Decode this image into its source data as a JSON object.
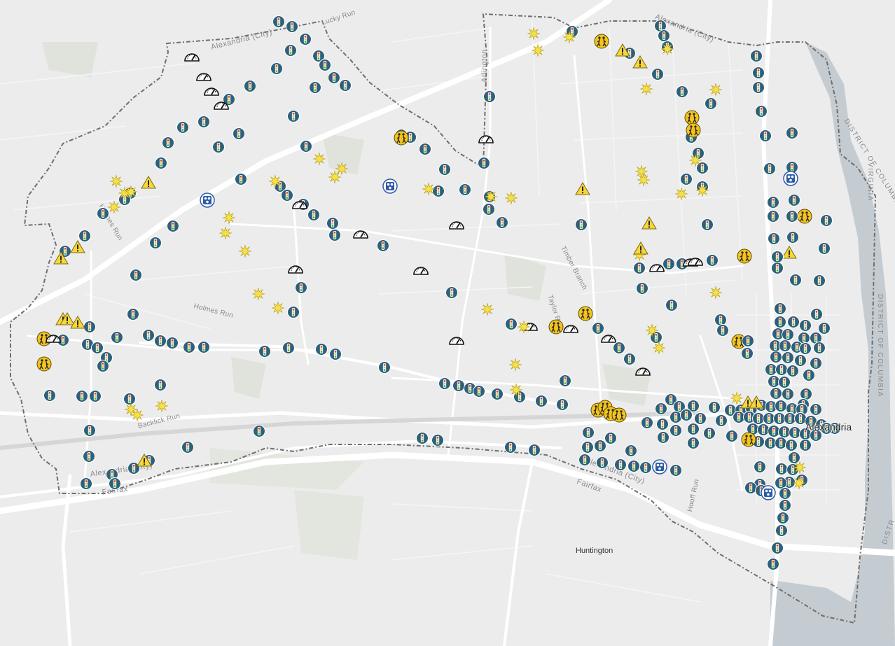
{
  "map": {
    "colors": {
      "background": "#ececec",
      "water": "#c4ccd2",
      "park": "#dfe3dc",
      "road_major": "#ffffff",
      "road_minor": "#fafafa",
      "boundary": "#6e6e6e",
      "signal_fill": "#2e6079",
      "signal_red": "#e53b2f",
      "signal_yellow": "#f2c12e",
      "signal_green": "#3dbb4a",
      "star_fill": "#f5e04a",
      "warning_fill": "#f7d63a",
      "school_fill": "#f3c31e",
      "speed_fill": "#ffffff",
      "police_fill": "#2d5aa6"
    },
    "labels": {
      "alexandria": "Alexandria",
      "huntington": "Huntington",
      "alexandria_city_top_left": "Alexandria (City)",
      "alexandria_city_top_right": "Alexandria (City)",
      "alexandria_city_bottom_left": "Alexandria (City)",
      "alexandria_city_bottom_right": "Alexandria (City)",
      "fairfax_bottom_left": "Fairfax",
      "fairfax_bottom_right": "Fairfax",
      "arlington": "Arlington",
      "lucky_run": "Lucky Run",
      "holmes_run_upper": "Holmes Run",
      "holmes_run_lower": "Holmes Run",
      "backlick_run": "Backlick Run",
      "timber_branch": "Timber Branch",
      "taylor_run": "Taylor R...",
      "hooff_run": "Hooff Run",
      "virginia": "VIRGINIA",
      "district_of_columbia_upper": "DISTRICT OF COLUMBIA",
      "district_of_columbia_lower": "DISTRICT OF COLUMBIA",
      "district_bottom": "DISTR"
    },
    "layers": [
      {
        "name": "traffic_signals",
        "icon": "traffic-signal-icon"
      },
      {
        "name": "sun_burst",
        "icon": "sun-burst-icon"
      },
      {
        "name": "warnings",
        "icon": "warning-triangle-icon"
      },
      {
        "name": "school_crossings",
        "icon": "school-crossing-icon"
      },
      {
        "name": "speed_cameras",
        "icon": "speedometer-icon"
      },
      {
        "name": "police_stations",
        "icon": "police-station-icon"
      }
    ]
  }
}
